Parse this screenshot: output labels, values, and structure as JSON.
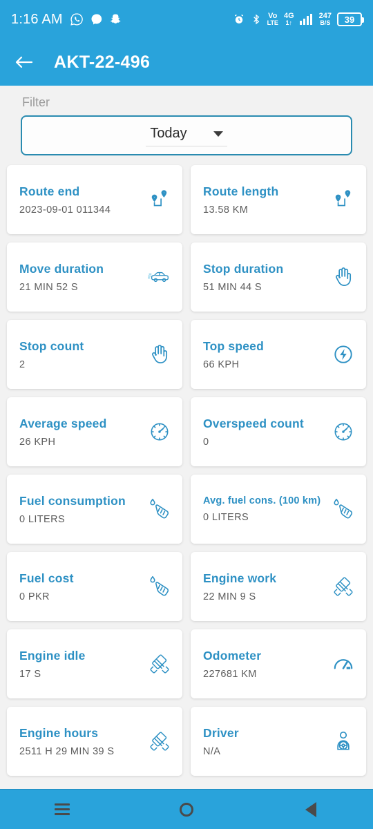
{
  "status_bar": {
    "time": "1:16 AM",
    "left_icons": [
      "whatsapp-icon",
      "messenger-icon",
      "snapchat-icon"
    ],
    "right_icons": [
      "alarm-icon",
      "bluetooth-icon"
    ],
    "volte_top": "Vo",
    "volte_bottom": "LTE",
    "network_top": "4G",
    "network_bottom": "1↑",
    "data_speed_value": "247",
    "data_speed_unit": "B/S",
    "battery_percent": "39"
  },
  "app_bar": {
    "back_icon": "arrow-left-icon",
    "title": "AKT-22-496"
  },
  "filter": {
    "label": "Filter",
    "selected": "Today",
    "caret_icon": "chevron-down-icon"
  },
  "cards": [
    {
      "title": "Route end",
      "value": "2023-09-01 011344",
      "icon": "route-pins-icon",
      "small_title": false
    },
    {
      "title": "Route length",
      "value": "13.58 KM",
      "icon": "route-pins-icon",
      "small_title": false
    },
    {
      "title": "Move duration",
      "value": "21 MIN 52 S",
      "icon": "car-icon",
      "small_title": false
    },
    {
      "title": "Stop duration",
      "value": "51 MIN 44 S",
      "icon": "hand-icon",
      "small_title": false
    },
    {
      "title": "Stop count",
      "value": "2",
      "icon": "hand-icon",
      "small_title": false
    },
    {
      "title": "Top speed",
      "value": "66 KPH",
      "icon": "bolt-circle-icon",
      "small_title": false
    },
    {
      "title": "Average speed",
      "value": "26 KPH",
      "icon": "speedometer-icon",
      "small_title": false
    },
    {
      "title": "Overspeed count",
      "value": "0",
      "icon": "speedometer-icon",
      "small_title": false
    },
    {
      "title": "Fuel consumption",
      "value": "0 LITERS",
      "icon": "fuel-nozzle-icon",
      "small_title": false
    },
    {
      "title": "Avg. fuel cons. (100 km)",
      "value": "0 LITERS",
      "icon": "fuel-nozzle-icon",
      "small_title": true
    },
    {
      "title": "Fuel cost",
      "value": "0 PKR",
      "icon": "fuel-nozzle-icon",
      "small_title": false
    },
    {
      "title": "Engine work",
      "value": "22 MIN 9 S",
      "icon": "engine-icon",
      "small_title": false
    },
    {
      "title": "Engine idle",
      "value": "17 S",
      "icon": "engine-icon",
      "small_title": false
    },
    {
      "title": "Odometer",
      "value": "227681 KM",
      "icon": "odometer-icon",
      "small_title": false
    },
    {
      "title": "Engine hours",
      "value": "2511 H 29 MIN 39 S",
      "icon": "engine-icon",
      "small_title": false
    },
    {
      "title": "Driver",
      "value": "N/A",
      "icon": "driver-icon",
      "small_title": false
    }
  ],
  "nav_bar": {
    "recents_icon": "recents-icon",
    "home_icon": "home-circle-icon",
    "back_icon": "back-triangle-icon"
  },
  "colors": {
    "brand_blue": "#29a3db",
    "accent_blue": "#2e91c4",
    "page_bg": "#f2f2f2",
    "card_bg": "#ffffff",
    "value_gray": "#5c5c5c"
  }
}
